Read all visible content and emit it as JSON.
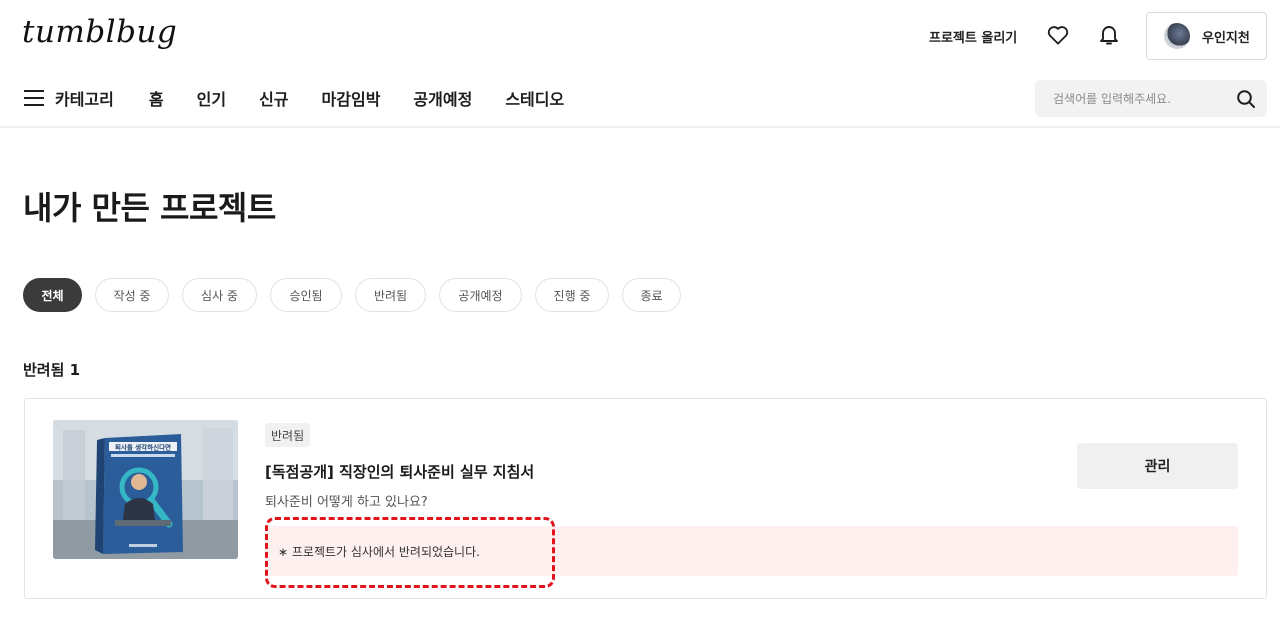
{
  "header": {
    "logo": "tumblbug",
    "upload_label": "프로젝트 올리기",
    "profile_name": "우인지천"
  },
  "nav": {
    "category_label": "카테고리",
    "items": [
      "홈",
      "인기",
      "신규",
      "마감임박",
      "공개예정",
      "스테디오"
    ]
  },
  "search": {
    "placeholder": "검색어를 입력해주세요."
  },
  "page": {
    "title": "내가 만든 프로젝트"
  },
  "filters": [
    "전체",
    "작성 중",
    "심사 중",
    "승인됨",
    "반려됨",
    "공개예정",
    "진행 중",
    "종료"
  ],
  "active_filter": "전체",
  "section": {
    "label": "반려됨 1"
  },
  "project": {
    "status": "반려됨",
    "title": "[독점공개] 직장인의 퇴사준비 실무 지침서",
    "subtitle": "퇴사준비 어떻게 하고 있나요?",
    "rejection_message": "∗ 프로젝트가 심사에서 반려되었습니다.",
    "manage_label": "관리",
    "thumbnail_title": "퇴사를 생각하신다면"
  },
  "colors": {
    "active_chip": "#3b3b3b",
    "reject_bg": "#fff0f0",
    "highlight": "#e0151b"
  }
}
